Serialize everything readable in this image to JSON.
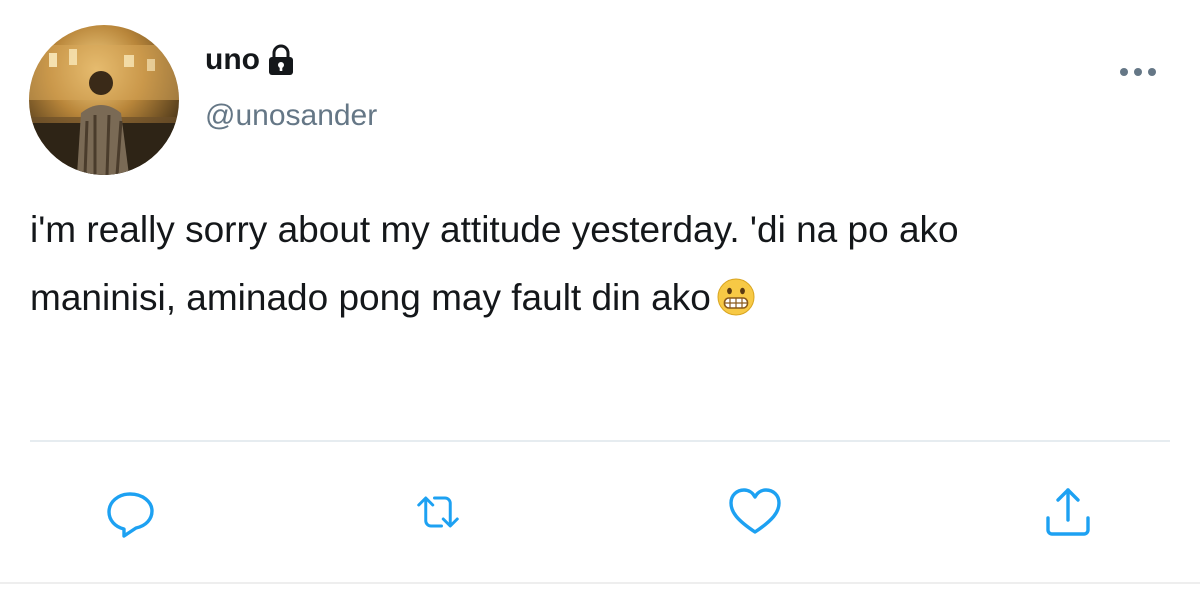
{
  "user": {
    "display_name": "uno",
    "handle": "@unosander",
    "protected": true
  },
  "tweet": {
    "text": "i'm really sorry about my attitude yesterday. 'di na po ako\nmaninisi, aminado pong may fault din ako",
    "emoji": "grimacing-face-emoji"
  },
  "actions": [
    "reply-icon",
    "retweet-icon",
    "like-icon",
    "share-icon"
  ],
  "colors": {
    "text": "#14171a",
    "secondary": "#657786",
    "icon": "#1da1f2",
    "divider": "#e6ecf0"
  }
}
